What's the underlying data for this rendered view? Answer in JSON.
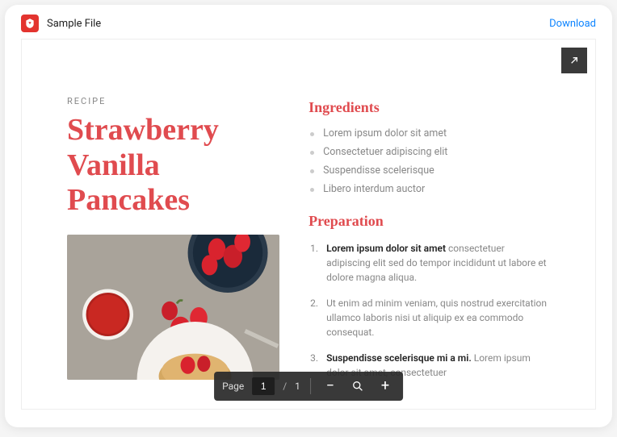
{
  "header": {
    "file_name": "Sample File",
    "download_label": "Download"
  },
  "document": {
    "kicker": "RECIPE",
    "title": "Strawberry Vanilla Pancakes",
    "ingredients_heading": "Ingredients",
    "ingredients": [
      "Lorem ipsum dolor sit amet",
      "Consectetuer adipiscing elit",
      "Suspendisse scelerisque",
      "Libero interdum auctor"
    ],
    "preparation_heading": "Preparation",
    "preparation": [
      {
        "lead": "Lorem ipsum dolor sit amet",
        "body": " consectetuer adipiscing elit sed do tempor incididunt ut labore et dolore magna aliqua."
      },
      {
        "lead": "",
        "body": "Ut enim ad minim veniam, quis nostrud exercitation ullamco laboris nisi ut aliquip ex ea commodo consequat."
      },
      {
        "lead": "Suspendisse scelerisque mi a mi.",
        "body": " Lorem ipsum dolor sit amet, consectetuer"
      }
    ]
  },
  "toolbar": {
    "page_label": "Page",
    "current_page": "1",
    "page_separator": "/",
    "total_pages": "1"
  }
}
